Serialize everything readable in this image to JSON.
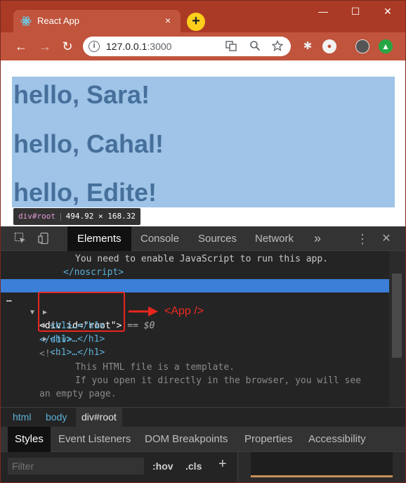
{
  "browser": {
    "tab_title": "React App",
    "tab_close": "×",
    "new_tab": "+",
    "window_controls": {
      "minimize": "—",
      "maximize": "☐",
      "close": "✕"
    },
    "nav": {
      "back": "←",
      "forward": "→",
      "reload": "↻"
    },
    "url_host": "127.0.0.1",
    "url_port": ":3000",
    "omnibox_info": "i"
  },
  "page": {
    "headings": [
      "hello, Sara!",
      "hello, Cahal!",
      "hello, Edite!"
    ],
    "tooltip_tag": "div#root",
    "tooltip_size": "494.92 × 168.32"
  },
  "devtools": {
    "tabs": [
      "Elements",
      "Console",
      "Sources",
      "Network"
    ],
    "more": "»",
    "menu": "⋮",
    "close": "✕",
    "dom": {
      "noscript_text": "You need to enable JavaScript to run this app.",
      "noscript_close": "</noscript>",
      "ellipsis": "…",
      "div_open_tag": "<div ",
      "div_attr_name": "id=",
      "div_attr_value": "\"root\"",
      "div_open_close": ">",
      "sel_marker": "== $0",
      "h1_collapsed": [
        "<h1>…</h1>",
        "<h1>…</h1>",
        "<h1>…</h1>"
      ],
      "div_close": "</div>",
      "comment_open": "<!--",
      "comment_line1": "This HTML file is a template.",
      "comment_line2": "If you open it directly in the browser, you will see",
      "comment_line3": "an empty page."
    },
    "annotation_label": "<App />",
    "breadcrumbs": [
      "html",
      "body",
      "div#root"
    ],
    "subtabs": [
      "Styles",
      "Event Listeners",
      "DOM Breakpoints",
      "Properties",
      "Accessibility"
    ],
    "filter_placeholder": "Filter",
    "hov": ":hov",
    "cls": ".cls",
    "add": "+"
  },
  "colors": {
    "titlebar": "#aa3a25",
    "toolbar": "#c0543c",
    "highlight": "#9fc4e7",
    "heading": "#46709b",
    "annotation": "#e8261e",
    "selection": "#3c7fd9"
  }
}
